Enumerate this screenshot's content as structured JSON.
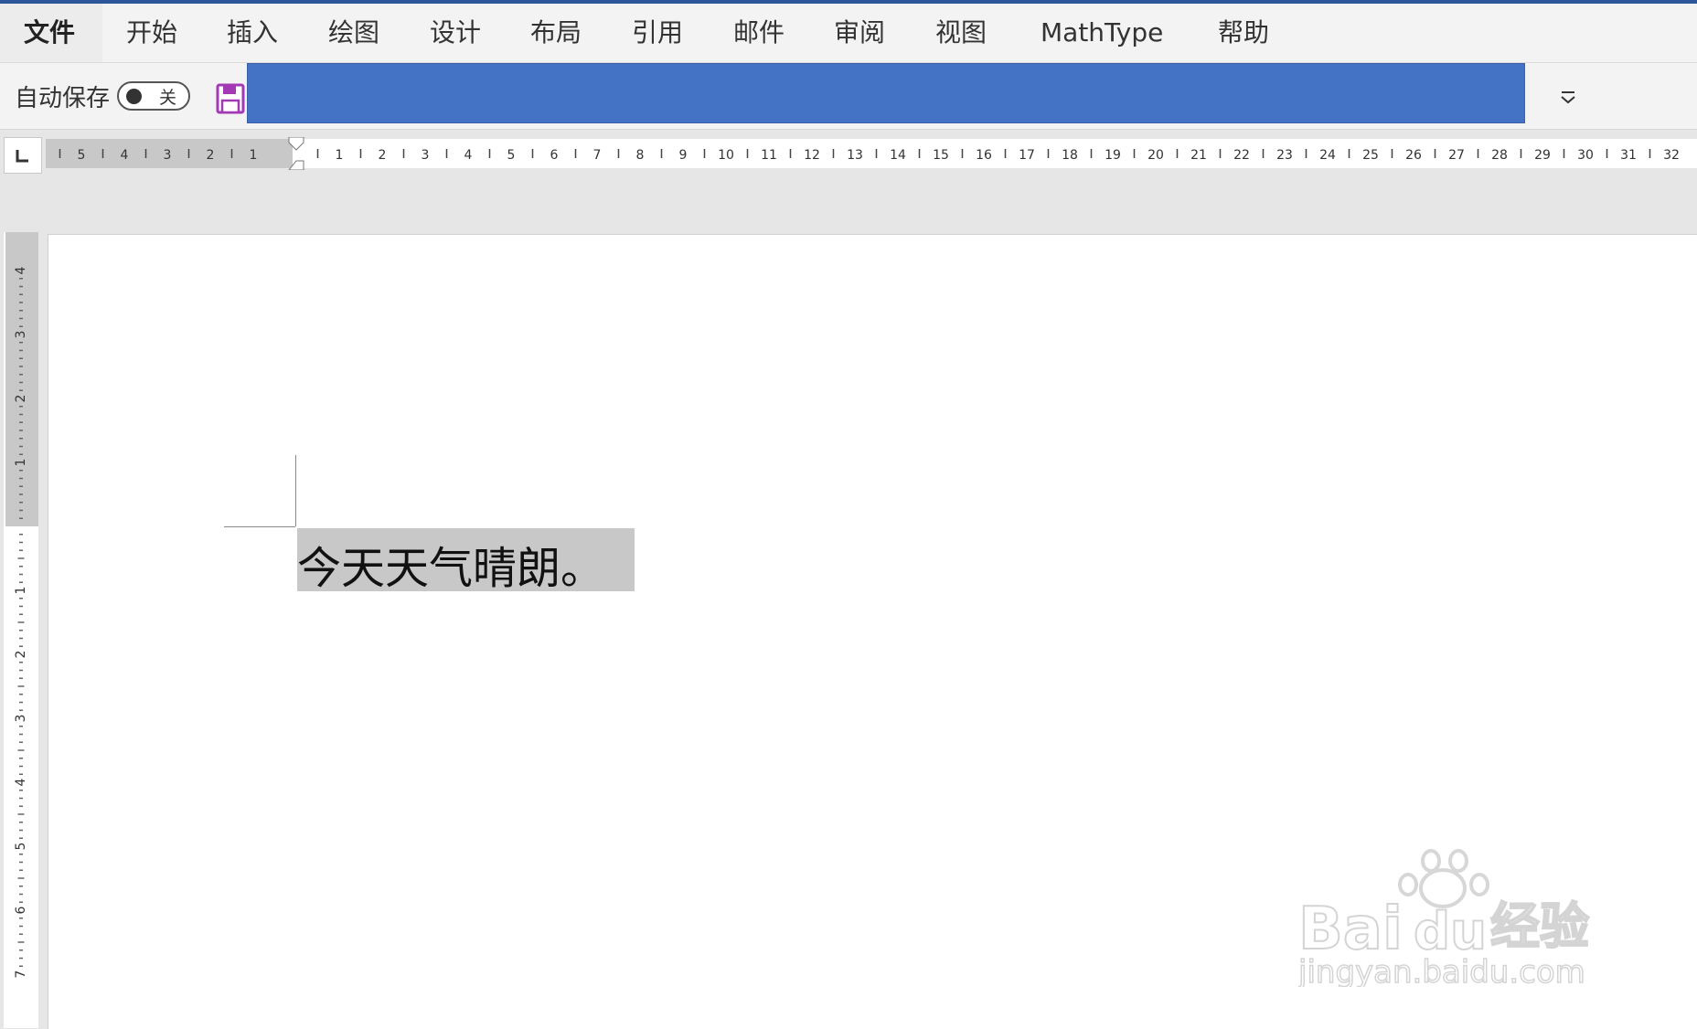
{
  "ribbon": {
    "tabs": [
      {
        "label": "文件"
      },
      {
        "label": "开始"
      },
      {
        "label": "插入"
      },
      {
        "label": "绘图"
      },
      {
        "label": "设计"
      },
      {
        "label": "布局"
      },
      {
        "label": "引用"
      },
      {
        "label": "邮件"
      },
      {
        "label": "审阅"
      },
      {
        "label": "视图"
      },
      {
        "label": "MathType"
      },
      {
        "label": "帮助"
      }
    ]
  },
  "quick_access": {
    "autosave_label": "自动保存",
    "autosave_state": "关",
    "title_bar_color": "#4472c4",
    "icons": [
      "save-icon",
      "customize-qat-icon"
    ]
  },
  "ruler": {
    "horizontal_left_labels": [
      "5",
      "4",
      "3",
      "2",
      "1"
    ],
    "horizontal_right_labels": [
      "1",
      "2",
      "3",
      "4",
      "5",
      "6",
      "7",
      "8",
      "9",
      "10",
      "11",
      "12",
      "13",
      "14",
      "15",
      "16",
      "17",
      "18",
      "19",
      "20",
      "21",
      "22",
      "23",
      "24",
      "25",
      "26",
      "27",
      "28",
      "29",
      "30",
      "31",
      "32"
    ],
    "vertical_top_labels": [
      "4",
      "3",
      "2",
      "1"
    ],
    "vertical_bottom_labels": [
      "1",
      "2",
      "3",
      "4",
      "5",
      "6",
      "7"
    ]
  },
  "document": {
    "text": "今天天气晴朗。",
    "selection_color": "#c8c8c8"
  },
  "watermark": {
    "brand": "Bai",
    "brand2": "du",
    "brand_cn": "经验",
    "url": "jingyan.baidu.com"
  },
  "colors": {
    "accent": "#2b579a",
    "save_icon": "#a33ab5"
  }
}
